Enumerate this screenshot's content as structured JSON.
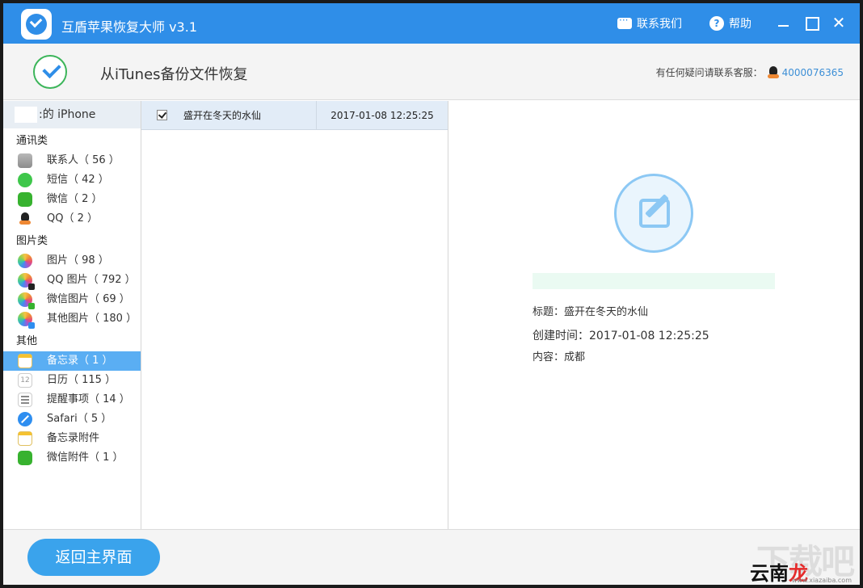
{
  "app": {
    "title": "互盾苹果恢复大师 v3.1",
    "contact_label": "联系我们",
    "help_label": "帮助",
    "close_glyph": "✕",
    "accent_color": "#2f8ee8"
  },
  "header": {
    "title": "从iTunes备份文件恢复",
    "support_prefix": "有任何疑问请联系客服：",
    "support_number": "4000076365"
  },
  "sidebar": {
    "device_name": ":的 iPhone",
    "groups": [
      {
        "title": "通讯类",
        "items": [
          {
            "label": "联系人（ 56 ）",
            "icon": "contacts-icon"
          },
          {
            "label": "短信（ 42 ）",
            "icon": "sms-icon"
          },
          {
            "label": "微信（ 2 ）",
            "icon": "wechat-icon"
          },
          {
            "label": "QQ（ 2 ）",
            "icon": "qq-icon"
          }
        ]
      },
      {
        "title": "图片类",
        "items": [
          {
            "label": "图片（ 98 ）",
            "icon": "photos-icon"
          },
          {
            "label": "QQ 图片（ 792 ）",
            "icon": "qq-photos-icon"
          },
          {
            "label": "微信图片（ 69 ）",
            "icon": "wechat-photos-icon"
          },
          {
            "label": "其他图片（ 180 ）",
            "icon": "other-photos-icon"
          }
        ]
      },
      {
        "title": "其他",
        "items": [
          {
            "label": "备忘录（ 1 ）",
            "icon": "notes-icon",
            "active": true
          },
          {
            "label": "日历（ 115 ）",
            "icon": "calendar-icon",
            "icon_text": "12"
          },
          {
            "label": "提醒事项（ 14 ）",
            "icon": "reminders-icon"
          },
          {
            "label": "Safari（ 5 ）",
            "icon": "safari-icon"
          },
          {
            "label": "备忘录附件",
            "icon": "notes-attachment-icon"
          },
          {
            "label": "微信附件（ 1 ）",
            "icon": "wechat-attachment-icon"
          }
        ]
      }
    ]
  },
  "list": {
    "rows": [
      {
        "title": "盛开在冬天的水仙",
        "date": "2017-01-08 12:25:25",
        "checked": true
      }
    ]
  },
  "detail": {
    "title_line": "标题：盛开在冬天的水仙",
    "created_line": "创建时间：2017-01-08 12:25:25",
    "content_line": "内容：成都"
  },
  "footer": {
    "back_label": "返回主界面",
    "watermark_big": "下载吧",
    "watermark_brand_a": "云南",
    "watermark_brand_b": "龙网",
    "watermark_url": "www.xiazaiba.com"
  }
}
